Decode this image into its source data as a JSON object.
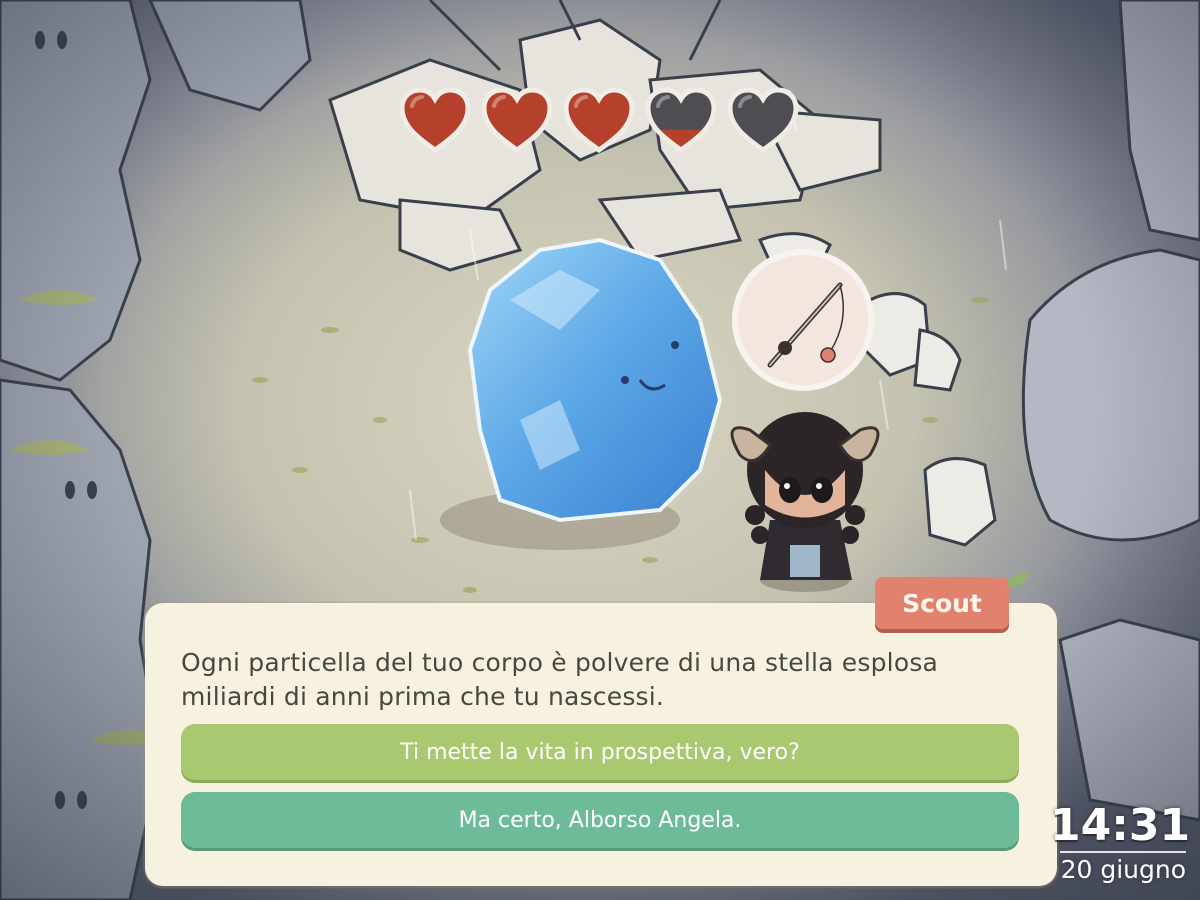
{
  "hud": {
    "hearts": [
      {
        "fill": 1.0
      },
      {
        "fill": 1.0
      },
      {
        "fill": 1.0
      },
      {
        "fill": 0.35
      },
      {
        "fill": 0.0
      }
    ],
    "heart_color": "#b5412c",
    "heart_empty_color": "#4d4d52"
  },
  "dialog": {
    "speaker": "Scout",
    "text": "Ogni particella del tuo corpo è polvere di una stella esplosa miliardi di anni prima che tu nascessi.",
    "choices": [
      {
        "label": "Ti mette la vita in prospettiva, vero?"
      },
      {
        "label": "Ma certo, Alborso Angela."
      }
    ]
  },
  "clock": {
    "time": "14:31",
    "date": "20 giugno"
  },
  "thought_bubble": {
    "icon": "fishing-rod-icon"
  },
  "colors": {
    "dialog_bg": "#f7f2df",
    "speaker_tag": "#e0826e",
    "choice_primary": "#a8c96f",
    "choice_secondary": "#6dbb98"
  }
}
